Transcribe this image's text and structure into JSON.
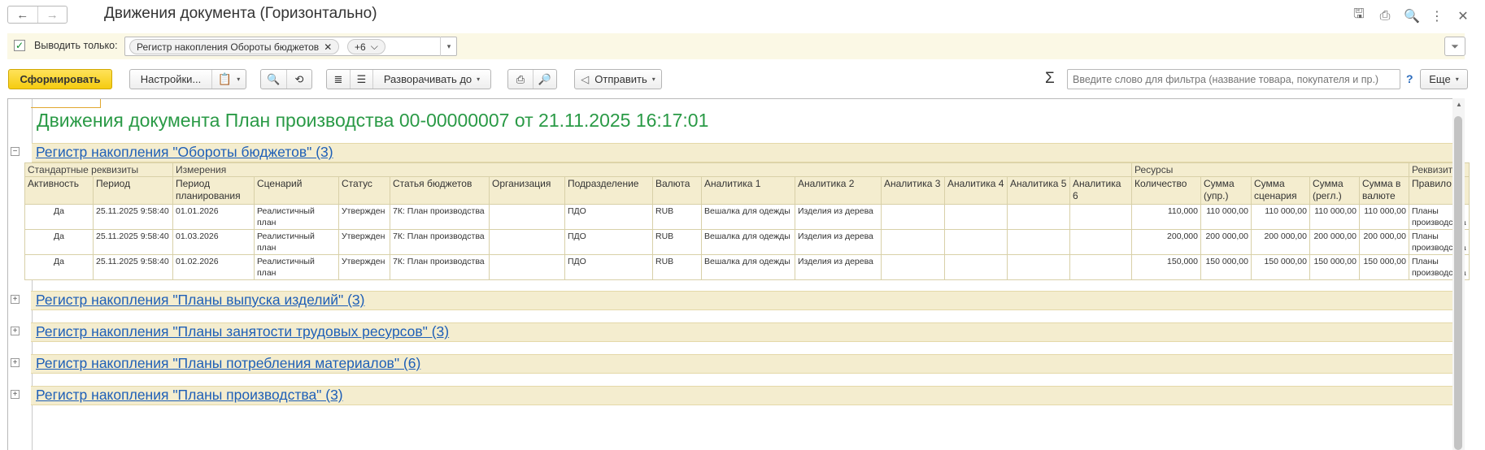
{
  "window": {
    "title": "Движения документа (Горизонтально)",
    "icons": [
      {
        "name": "save-icon",
        "glyph": "🖫"
      },
      {
        "name": "print-icon",
        "glyph": "⎙"
      },
      {
        "name": "preview-icon",
        "glyph": "🔍"
      },
      {
        "name": "more-vert-icon",
        "glyph": "⋮"
      },
      {
        "name": "close-icon",
        "glyph": "✕"
      }
    ],
    "nav_back": "←",
    "nav_forward": "→"
  },
  "filter": {
    "checkbox_mark": "✓",
    "label": "Выводить только:",
    "chip": "Регистр накопления Обороты бюджетов",
    "chip_close": "✕",
    "chip_more": "+6",
    "chip_more_caret": "⌵",
    "dropdown": "▾",
    "funnel": "⏷"
  },
  "toolbar": {
    "generate": "Сформировать",
    "settings": "Настройки...",
    "variants_icon": "📋",
    "caret": "▾",
    "find_icon": "🔍",
    "find_next_icon": "⟲",
    "outline_collapse_icon": "≣",
    "outline_expand_icon": "☰",
    "expand_to": "Разворачивать до",
    "print_icon": "⎙",
    "preview_icon": "🔎",
    "send_icon": "◁",
    "send": "Отправить",
    "sigma": "Σ",
    "search_placeholder": "Введите слово для фильтра (название товара, покупателя и пр.)",
    "help": "?",
    "more": "Еще"
  },
  "report": {
    "title": "Движения документа План производства 00-00000007 от 21.11.2025 16:17:01",
    "expanded_group": {
      "title": "Регистр накопления \"Обороты бюджетов\" (3)",
      "toggle": "−",
      "bands": {
        "standard": "Стандартные реквизиты",
        "dimensions": "Измерения",
        "resources": "Ресурсы",
        "attributes": "Реквизиты"
      },
      "columns": [
        "Активность",
        "Период",
        "Период планирования",
        "Сценарий",
        "Статус",
        "Статья бюджетов",
        "Организация",
        "Подразделение",
        "Валюта",
        "Аналитика 1",
        "Аналитика 2",
        "Аналитика 3",
        "Аналитика 4",
        "Аналитика 5",
        "Аналитика 6",
        "Количество",
        "Сумма (упр.)",
        "Сумма сценария",
        "Сумма (регл.)",
        "Сумма в валюте",
        "Правило"
      ],
      "rows": [
        [
          "Да",
          "25.11.2025 9:58:40",
          "01.01.2026",
          "Реалистичный план",
          "Утвержден",
          "7К: План производства",
          "",
          "ПДО",
          "RUB",
          "Вешалка для одежды",
          "Изделия из дерева",
          "",
          "",
          "",
          "",
          "110,000",
          "110 000,00",
          "110 000,00",
          "110 000,00",
          "110 000,00",
          "Планы производства"
        ],
        [
          "Да",
          "25.11.2025 9:58:40",
          "01.03.2026",
          "Реалистичный план",
          "Утвержден",
          "7К: План производства",
          "",
          "ПДО",
          "RUB",
          "Вешалка для одежды",
          "Изделия из дерева",
          "",
          "",
          "",
          "",
          "200,000",
          "200 000,00",
          "200 000,00",
          "200 000,00",
          "200 000,00",
          "Планы производства"
        ],
        [
          "Да",
          "25.11.2025 9:58:40",
          "01.02.2026",
          "Реалистичный план",
          "Утвержден",
          "7К: План производства",
          "",
          "ПДО",
          "RUB",
          "Вешалка для одежды",
          "Изделия из дерева",
          "",
          "",
          "",
          "",
          "150,000",
          "150 000,00",
          "150 000,00",
          "150 000,00",
          "150 000,00",
          "Планы производства"
        ]
      ]
    },
    "collapsed_groups": [
      {
        "title": "Регистр накопления \"Планы выпуска изделий\" (3)",
        "toggle": "+"
      },
      {
        "title": "Регистр накопления \"Планы занятости трудовых ресурсов\" (3)",
        "toggle": "+"
      },
      {
        "title": "Регистр накопления \"Планы потребления материалов\" (6)",
        "toggle": "+"
      },
      {
        "title": "Регистр накопления \"Планы производства\" (3)",
        "toggle": "+"
      }
    ],
    "scroll_up": "▲"
  },
  "colors": {
    "accent_yellow": "#f5cc10",
    "title_green": "#2a9a46",
    "link_blue": "#1e5fb7",
    "group_bg": "#f4edcf"
  }
}
